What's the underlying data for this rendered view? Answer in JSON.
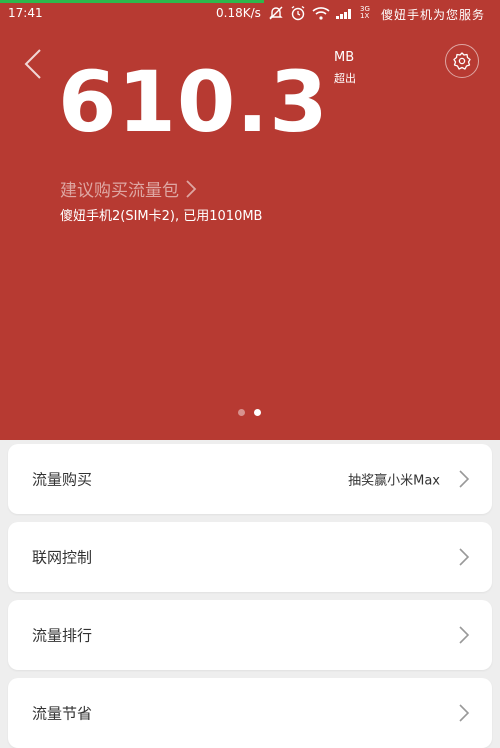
{
  "status_bar": {
    "time": "17:41",
    "speed": "0.18K/s",
    "net_top": "3G",
    "net_bottom": "1X",
    "carrier": "傻妞手机为您服务"
  },
  "hero": {
    "value": "610.3",
    "unit": "MB",
    "unit_sub": "超出",
    "buy_link": "建议购买流量包",
    "sim_info": "傻妞手机2(SIM卡2), 已用1010MB",
    "page_count": 2,
    "active_page": 2
  },
  "menu": {
    "items": [
      {
        "label": "流量购买",
        "extra": "抽奖赢小米Max"
      },
      {
        "label": "联网控制"
      },
      {
        "label": "流量排行"
      },
      {
        "label": "流量节省"
      }
    ]
  },
  "colors": {
    "accent": "#b73a32",
    "background": "#eeeeee",
    "progress": "#2db84c"
  },
  "icons": [
    "back-arrow-icon",
    "settings-gear-icon",
    "chevron-right-icon",
    "wifi-icon",
    "alarm-icon",
    "signal-icon"
  ]
}
